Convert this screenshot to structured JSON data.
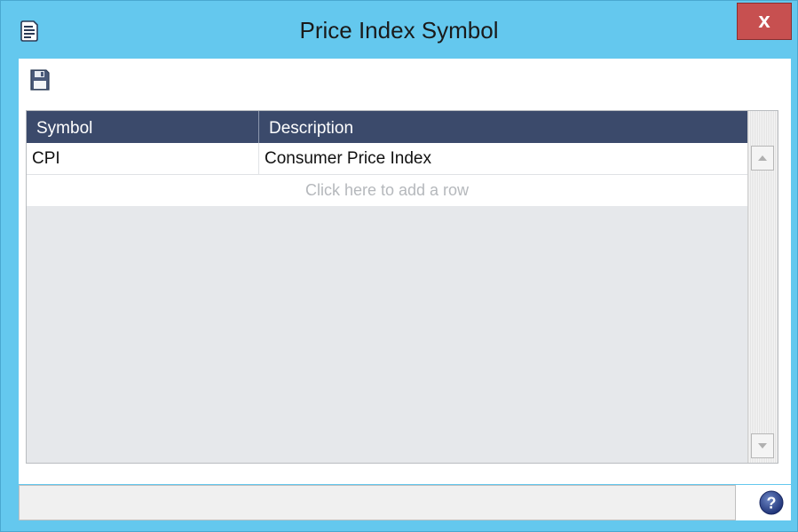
{
  "window": {
    "title": "Price Index Symbol",
    "close_label": "x",
    "accent_color": "#64c8ee",
    "close_color": "#c75050"
  },
  "toolbar": {
    "save_icon": "save-icon"
  },
  "grid": {
    "columns": [
      "Symbol",
      "Description"
    ],
    "rows": [
      {
        "symbol": "CPI",
        "description": "Consumer Price Index"
      }
    ],
    "add_row_text": "Click here to add a row",
    "header_color": "#3b4a6b"
  },
  "statusbar": {
    "text": "",
    "help_icon": "help-icon"
  }
}
